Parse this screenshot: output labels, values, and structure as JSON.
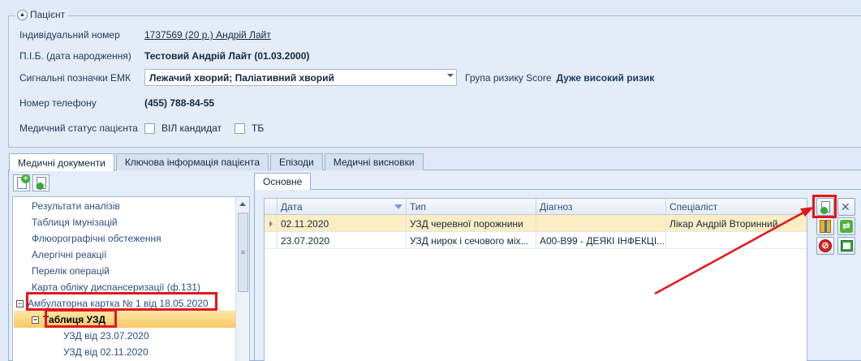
{
  "patient": {
    "title": "Пацієнт",
    "id_label": "Індивідуальний номер",
    "id_value": "1737569 (20 р.) Андрій Лайт",
    "name_label": "П.І.Б. (дата народження)",
    "name_value": "Тестовий Андрій Лайт (01.03.2000)",
    "signals_label": "Сигнальні позначки ЕМК",
    "signals_value": "Лежачий хворий; Паліативний хворий",
    "risk_label": "Група ризику Score",
    "risk_value": "Дуже високий ризик",
    "phone_label": "Номер телефону",
    "phone_value": "(455) 788-84-55",
    "status_label": "Медичний статус пацієнта",
    "status_options": [
      {
        "label": "ВІЛ кандидат",
        "checked": false
      },
      {
        "label": "ТБ",
        "checked": false
      }
    ]
  },
  "tabs": [
    "Медичні документи",
    "Ключова інформація пацієнта",
    "Епізоди",
    "Медичні висновки"
  ],
  "active_tab": "Медичні документи",
  "tree": {
    "items": [
      {
        "label": "Результати  аналізів"
      },
      {
        "label": "Таблиця Імунізацій"
      },
      {
        "label": "Флюорографічні обстеження"
      },
      {
        "label": "Алергічні реакції"
      },
      {
        "label": "Перелік операцій"
      },
      {
        "label": "Карта обліку диспансеризації (ф.131)"
      },
      {
        "label": "Амбулаторна картка № 1 від 18.05.2020",
        "expander": "−"
      },
      {
        "label": "Таблиця УЗД",
        "expander": "−",
        "selected": true
      },
      {
        "label": "УЗД від 23.07.2020"
      },
      {
        "label": "УЗД від 02.11.2020"
      }
    ]
  },
  "sub_tab": "Основне",
  "grid": {
    "columns": [
      "Дата",
      "Тип",
      "Діагноз",
      "Спеціаліст"
    ],
    "rows": [
      {
        "date": "02.11.2020",
        "type": "УЗД черевної порожнини",
        "diagnosis": "",
        "specialist": "Лікар Андрій Вторинний",
        "selected": true
      },
      {
        "date": "23.07.2020",
        "type": "УЗД нирок і сечового міх...",
        "diagnosis": "A00-B99 - ДЕЯКІ ІНФЕКЦІ...",
        "specialist": "",
        "selected": false
      }
    ]
  },
  "side_icons": [
    "add-document-icon",
    "tools-icon",
    "book-icon",
    "refresh-arrows-icon",
    "delete-icon",
    "spreadsheet-icon"
  ],
  "annotation_color": "#e3161c"
}
